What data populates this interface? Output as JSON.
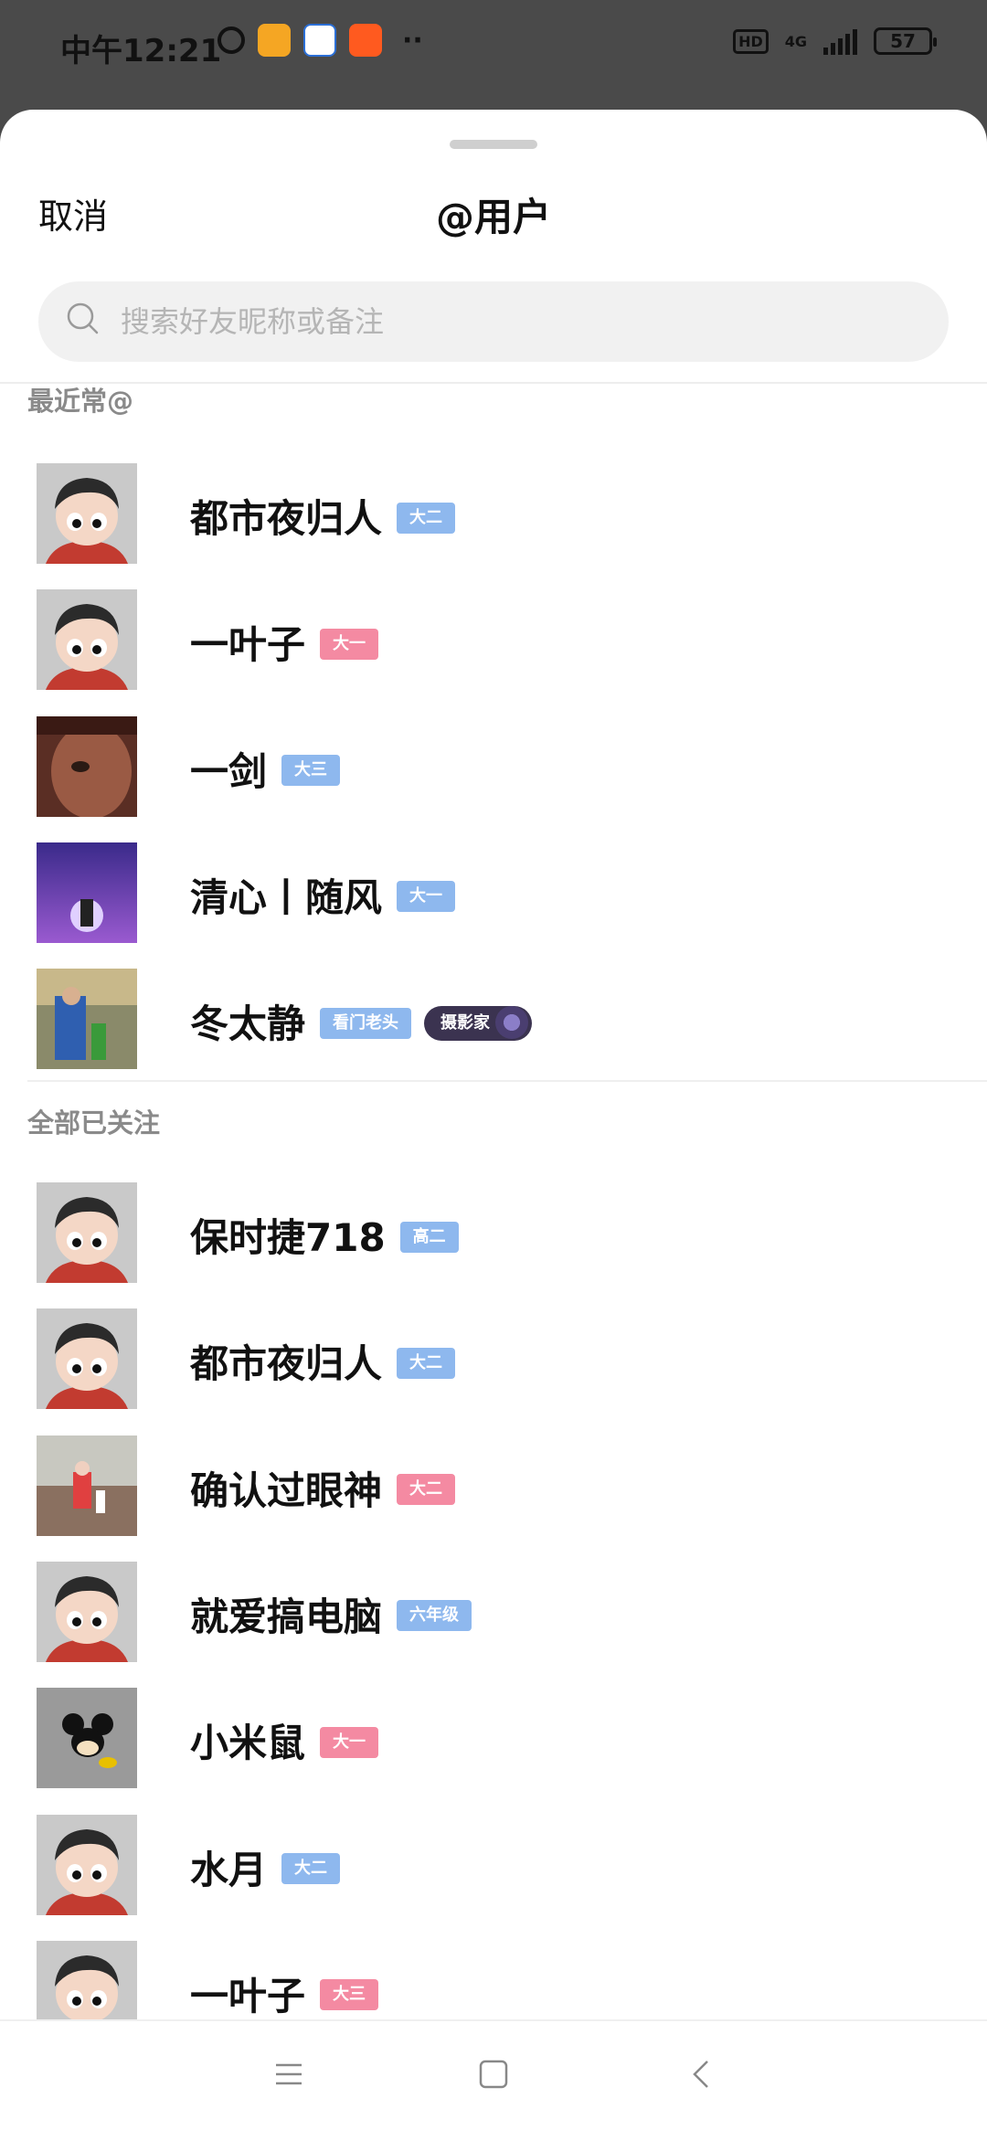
{
  "status_bar": {
    "time": "中午12:21",
    "network": "4G",
    "battery": "57",
    "hd": "HD"
  },
  "header": {
    "cancel_label": "取消",
    "title": "@用户"
  },
  "search": {
    "placeholder": "搜索好友昵称或备注",
    "value": ""
  },
  "sections": {
    "recent_title": "最近常@",
    "all_title": "全部已关注"
  },
  "recent": [
    {
      "name": "都市夜归人",
      "tag": "大二",
      "tag_color": "blue",
      "avatar": "cartoon"
    },
    {
      "name": "一叶子",
      "tag": "大一",
      "tag_color": "pink",
      "avatar": "cartoon"
    },
    {
      "name": "一剑",
      "tag": "大三",
      "tag_color": "blue",
      "avatar": "photo-face"
    },
    {
      "name": "清心丨随风",
      "tag": "大一",
      "tag_color": "blue",
      "avatar": "photo-purple"
    },
    {
      "name": "冬太静",
      "tag": "看门老头",
      "tag_color": "blue",
      "avatar": "photo-outdoor",
      "badge": "摄影家"
    }
  ],
  "following": [
    {
      "name": "保时捷718",
      "tag": "高二",
      "tag_color": "blue",
      "avatar": "cartoon"
    },
    {
      "name": "都市夜归人",
      "tag": "大二",
      "tag_color": "blue",
      "avatar": "cartoon"
    },
    {
      "name": "确认过眼神",
      "tag": "大二",
      "tag_color": "pink",
      "avatar": "photo-street"
    },
    {
      "name": "就爱搞电脑",
      "tag": "六年级",
      "tag_color": "blue",
      "avatar": "cartoon"
    },
    {
      "name": "小米鼠",
      "tag": "大一",
      "tag_color": "pink",
      "avatar": "photo-mouse"
    },
    {
      "name": "水月",
      "tag": "大二",
      "tag_color": "blue",
      "avatar": "cartoon"
    },
    {
      "name": "一叶子",
      "tag": "大三",
      "tag_color": "pink",
      "avatar": "cartoon"
    }
  ],
  "colors": {
    "tag_blue": "#8eb8ee",
    "tag_pink": "#f48aa2",
    "section_text": "#8a8a8a"
  },
  "nav": {
    "menu_icon": "menu-icon",
    "home_icon": "home-square-icon",
    "back_icon": "back-chevron-icon"
  }
}
